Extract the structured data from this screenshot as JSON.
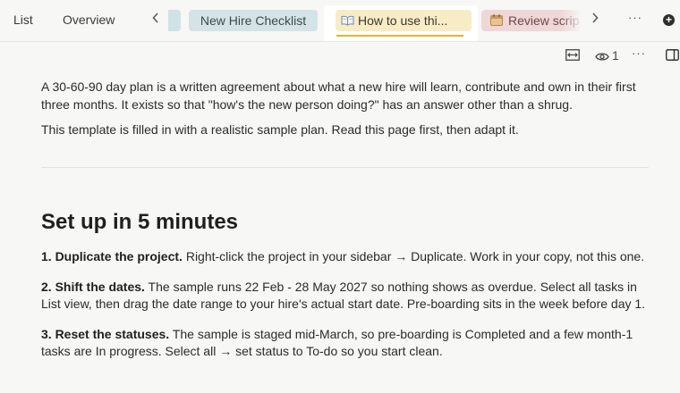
{
  "tabbar": {
    "view_tabs": [
      "List",
      "Overview"
    ],
    "prev_arrow": "‹",
    "next_arrow": "›",
    "doc_tabs": [
      {
        "label": "New Hire Checklist"
      },
      {
        "label": "How to use thi...",
        "icon": "open-book-icon"
      },
      {
        "label": "Review scrip",
        "icon": "calendar-icon"
      }
    ],
    "more": "···",
    "add": "+"
  },
  "toolbar": {
    "viewer_count": "1",
    "more": "···"
  },
  "doc": {
    "intro_1": "A 30-60-90 day plan is a written agreement about what a new hire will learn, contribute and own in their first three months. It exists so that \"how's the new person doing?\" has an answer other than a shrug.",
    "intro_2": "This template is filled in with a realistic sample plan. Read this page first, then adapt it.",
    "heading": "Set up in 5 minutes",
    "steps": [
      {
        "title": "1. Duplicate the project.",
        "text": " Right-click the project in your sidebar → Duplicate. Work in your copy, not this one."
      },
      {
        "title": "2. Shift the dates.",
        "text": " The sample runs 22 Feb - 28 May 2027 so nothing shows as overdue. Select all tasks in List view, then drag the date range to your hire's actual start date. Pre-boarding sits in the week before day 1."
      },
      {
        "title": "3. Reset the statuses.",
        "text": " The sample is staged mid-March, so pre-boarding is Completed and a few month-1 tasks are In progress. Select all → set status to To-do so you start clean."
      }
    ]
  },
  "colors": {
    "accent_underline": "#e5b32b",
    "tab_checklist_bg": "#d4e4e6",
    "tab_active_bg": "#f8ecc7",
    "tab_review_bg": "#efd7d7"
  }
}
